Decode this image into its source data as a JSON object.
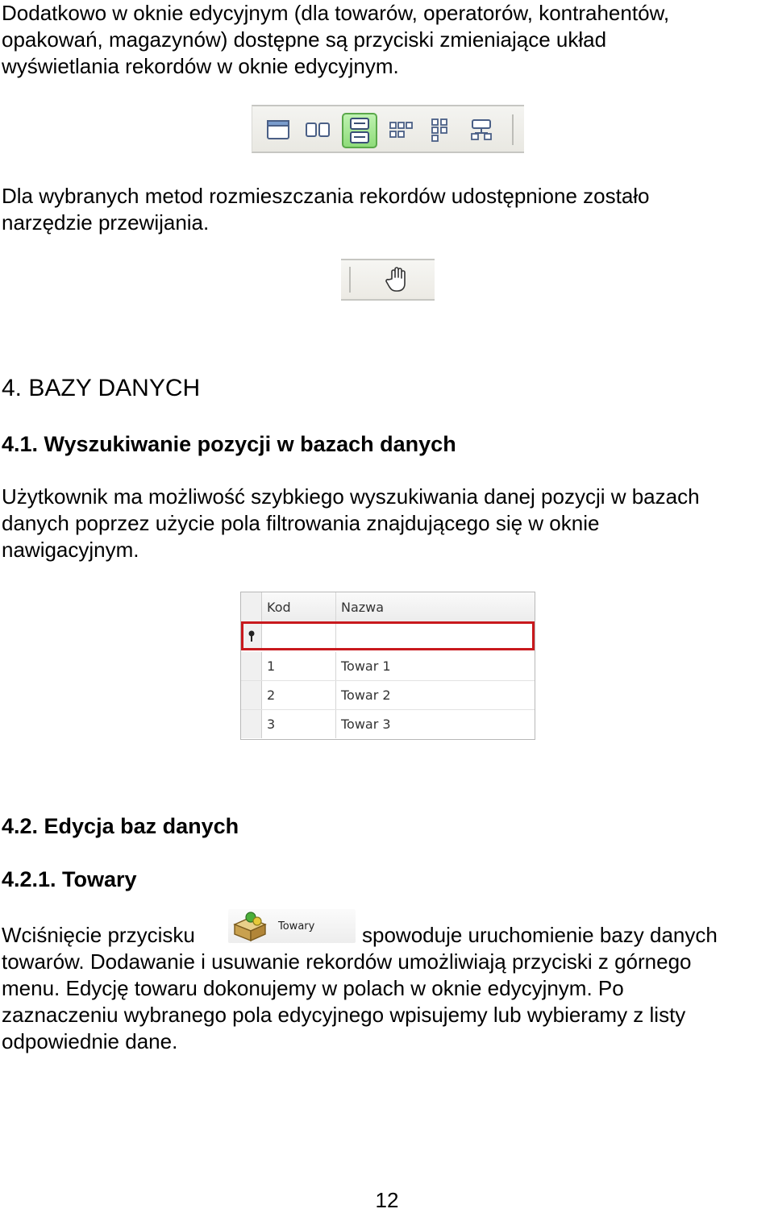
{
  "intro": {
    "lines": [
      "Dodatkowo w oknie edycyjnym (dla towarów, operatorów, kontrahentów,",
      "opakowań, magazynów) dostępne są przyciski zmieniające układ",
      "wyświetlania rekordów w oknie edycyjnym."
    ]
  },
  "scroll_note": {
    "lines": [
      "Dla wybranych metod rozmieszczania rekordów udostępnione zostało",
      "narzędzie przewijania."
    ]
  },
  "section4": {
    "title": "4. BAZY DANYCH"
  },
  "section41": {
    "title": "4.1. Wyszukiwanie pozycji w bazach danych",
    "lines": [
      "Użytkownik ma możliwość szybkiego wyszukiwania danej pozycji w bazach",
      "danych poprzez użycie pola filtrowania znajdującego się w oknie",
      "nawigacyjnym."
    ]
  },
  "grid": {
    "columns": [
      "Kod",
      "Nazwa"
    ],
    "rows": [
      {
        "kod": "1",
        "nazwa": "Towar 1"
      },
      {
        "kod": "2",
        "nazwa": "Towar 2"
      },
      {
        "kod": "3",
        "nazwa": "Towar 3"
      }
    ]
  },
  "section42": {
    "title": "4.2. Edycja baz danych"
  },
  "section421": {
    "title": "4.2.1. Towary",
    "line1_before": "Wciśnięcie przycisku",
    "button_label": "Towary",
    "line1_after": "spowoduje uruchomienie bazy danych",
    "lines": [
      "towarów. Dodawanie i usuwanie rekordów umożliwiają przyciski z górnego",
      "menu. Edycję towaru dokonujemy w polach w oknie edycyjnym. Po",
      "zaznaczeniu wybranego pola edycyjnego wpisujemy lub wybieramy z listy",
      "odpowiednie dane."
    ]
  },
  "page_number": "12",
  "colors": {
    "filter_border": "#c8191d",
    "active_button": "#8fdc7a"
  },
  "icons": {
    "toolbar": [
      "single-record-icon",
      "two-columns-icon",
      "two-rows-icon",
      "card-grid-icon",
      "vertical-cards-icon",
      "tree-layout-icon"
    ],
    "scroll": "hand-icon",
    "towary": "goods-box-icon"
  }
}
